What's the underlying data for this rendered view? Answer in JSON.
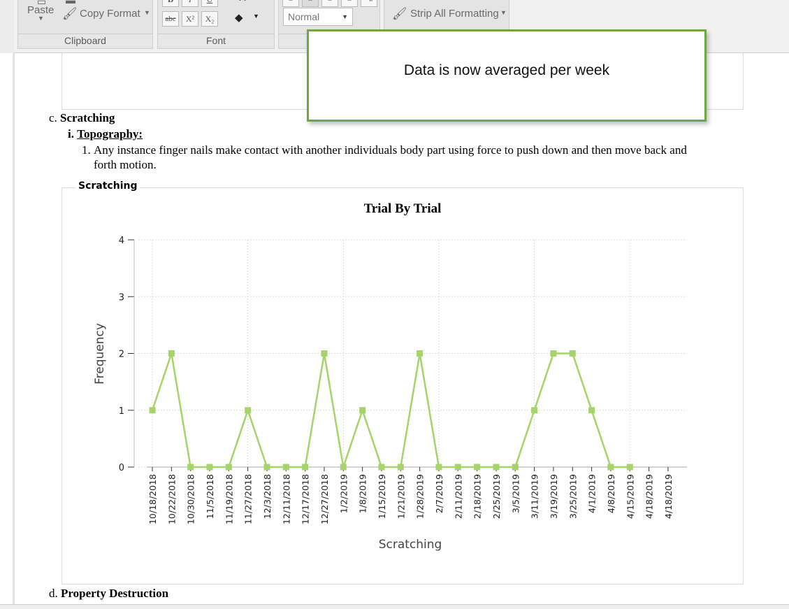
{
  "ribbon": {
    "clipboard": {
      "paste_label": "Paste",
      "copy_format_label": "Copy Format",
      "group_label": "Clipboard"
    },
    "font": {
      "group_label": "Font",
      "bold": "B",
      "italic": "I",
      "underline": "U",
      "strike": "abc",
      "superscript": "X²",
      "subscript": "X₂"
    },
    "paragraph": {
      "style_value": "Normal"
    },
    "formatting": {
      "strip_label": "Strip All Formatting"
    }
  },
  "toast": {
    "message": "Data is now averaged per week"
  },
  "document": {
    "section_c": {
      "marker": "c.",
      "title": "Scratching"
    },
    "topography": {
      "marker": "i.",
      "label": "Topography:"
    },
    "definition": {
      "marker": "1.",
      "line1": "Any instance finger nails make contact with another individuals body part using force to push down and then move back and",
      "line2": "forth motion."
    },
    "chart_caption": "Scratching",
    "section_d": {
      "marker": "d.",
      "title": "Property Destruction"
    }
  },
  "chart_data": {
    "type": "line",
    "title": "Trial By Trial",
    "xlabel": "Scratching",
    "ylabel": "Frequency",
    "ylim": [
      0,
      4
    ],
    "yticks": [
      0,
      1,
      2,
      3,
      4
    ],
    "grid": true,
    "categories": [
      "10/18/2018",
      "10/22/2018",
      "10/30/2018",
      "11/5/2018",
      "11/19/2018",
      "11/27/2018",
      "12/3/2018",
      "12/11/2018",
      "12/17/2018",
      "12/27/2018",
      "1/2/2019",
      "1/8/2019",
      "1/15/2019",
      "1/21/2019",
      "1/28/2019",
      "2/7/2019",
      "2/11/2019",
      "2/18/2019",
      "2/25/2019",
      "3/5/2019",
      "3/11/2019",
      "3/19/2019",
      "3/25/2019",
      "4/1/2019",
      "4/8/2019",
      "4/15/2019",
      "4/18/2019",
      "4/18/2019"
    ],
    "series": [
      {
        "color": "#a5d46a",
        "values": [
          1,
          2,
          0,
          0,
          0,
          1,
          0,
          0,
          0,
          2,
          0,
          1,
          0,
          0,
          2,
          0,
          0,
          0,
          0,
          0,
          1,
          2,
          2,
          1,
          0,
          0,
          null,
          null
        ]
      }
    ]
  }
}
